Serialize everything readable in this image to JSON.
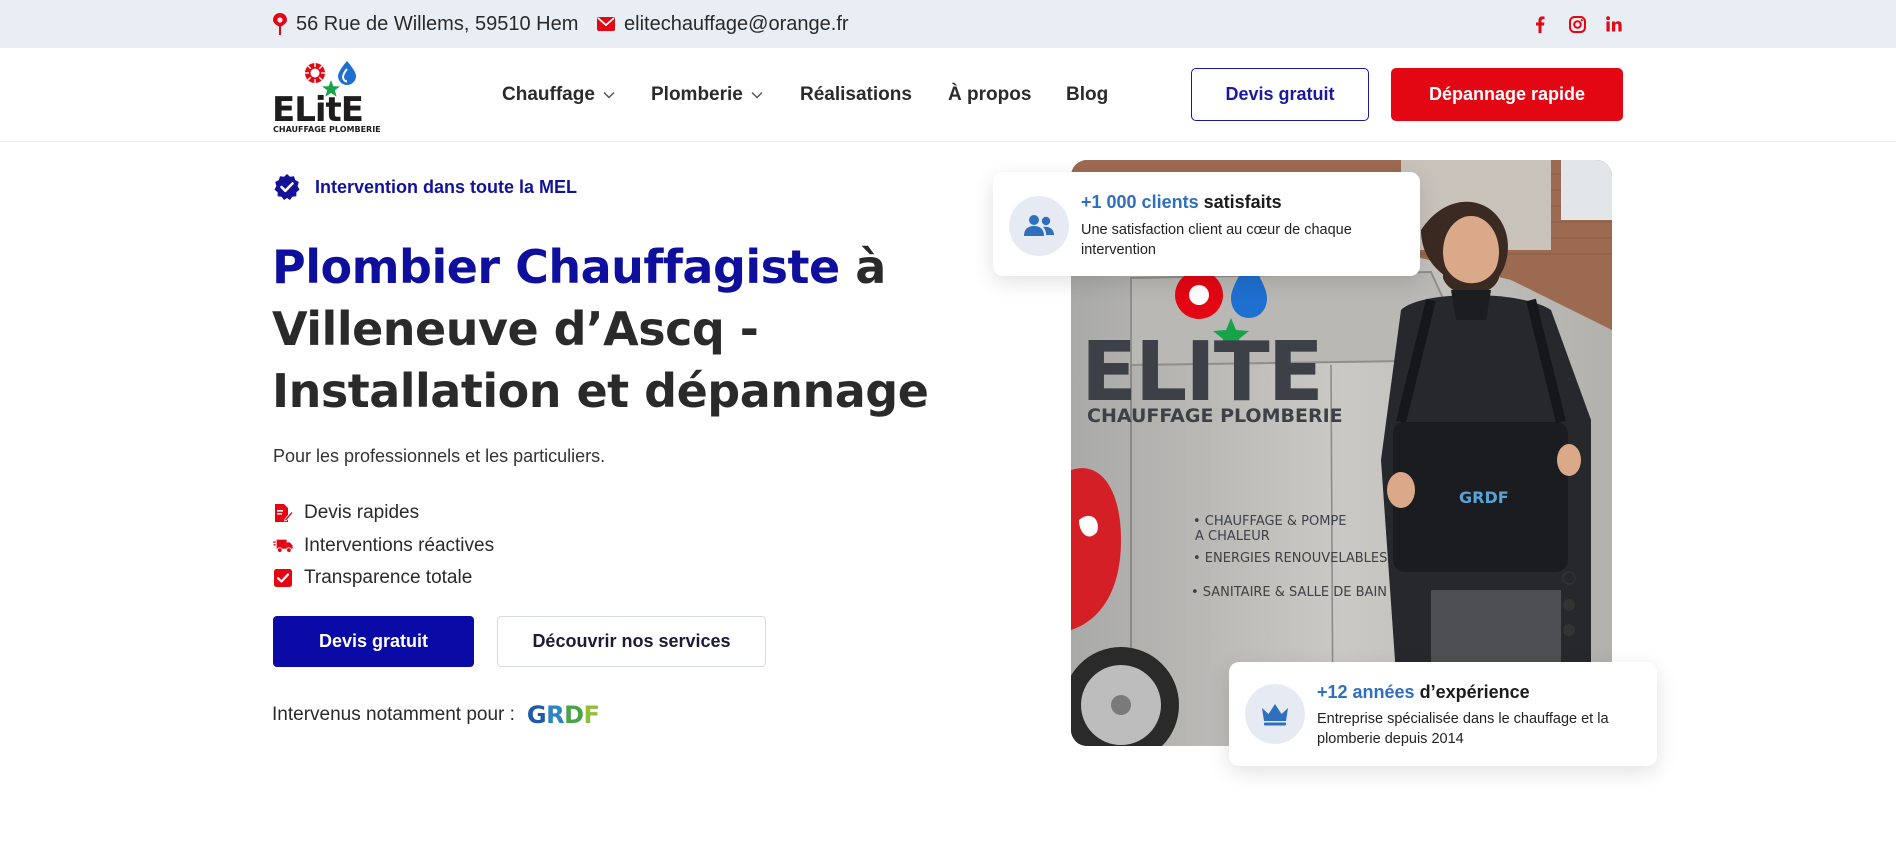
{
  "topbar": {
    "address": "56 Rue de Willems, 59510 Hem",
    "email": "elitechauffage@orange.fr",
    "social": [
      "facebook",
      "instagram",
      "linkedin"
    ]
  },
  "logo": {
    "name": "ELITE",
    "tagline": "CHAUFFAGE PLOMBERIE"
  },
  "nav": {
    "items": [
      "Chauffage",
      "Plomberie",
      "Réalisations",
      "À propos",
      "Blog"
    ]
  },
  "header_buttons": {
    "quote": "Devis gratuit",
    "emergency": "Dépannage rapide"
  },
  "hero": {
    "badge": "Intervention dans toute la MEL",
    "title_highlight": "Plombier Chauffagiste",
    "title_rest_1": " à",
    "title_rest_2": "Villeneuve d’Ascq -",
    "title_rest_3": "Installation et dépannage",
    "subtitle": "Pour les professionnels et les particuliers.",
    "features": [
      "Devis rapides",
      "Interventions réactives",
      "Transparence totale"
    ],
    "cta_primary": "Devis gratuit",
    "cta_secondary": "Découvrir nos services",
    "partners_label": "Intervenus notamment pour :",
    "partner_logo": "GRDF"
  },
  "stats": {
    "clients_num": "+1 000 clients",
    "clients_rest": " satisfaits",
    "clients_desc": "Une satisfaction client au cœur de chaque intervention",
    "years_num": "+12 années",
    "years_rest": " d’expérience",
    "years_desc": "Entreprise spécialisée dans le chauffage et la plomberie depuis 2014"
  },
  "van": {
    "brand": "ELITE",
    "tagline": "CHAUFFAGE PLOMBERIE",
    "services": [
      "• CHAUFFAGE & POMPE",
      "A CHALEUR",
      "• ENERGIES RENOUVELABLES",
      "• SANITAIRE & SALLE DE BAIN"
    ],
    "bag_logo": "GRDF"
  },
  "colors": {
    "brand_blue": "#0f0f9e",
    "accent_red": "#e30613",
    "stat_blue": "#2f6fbd",
    "topbar_bg": "#e9edf4"
  }
}
